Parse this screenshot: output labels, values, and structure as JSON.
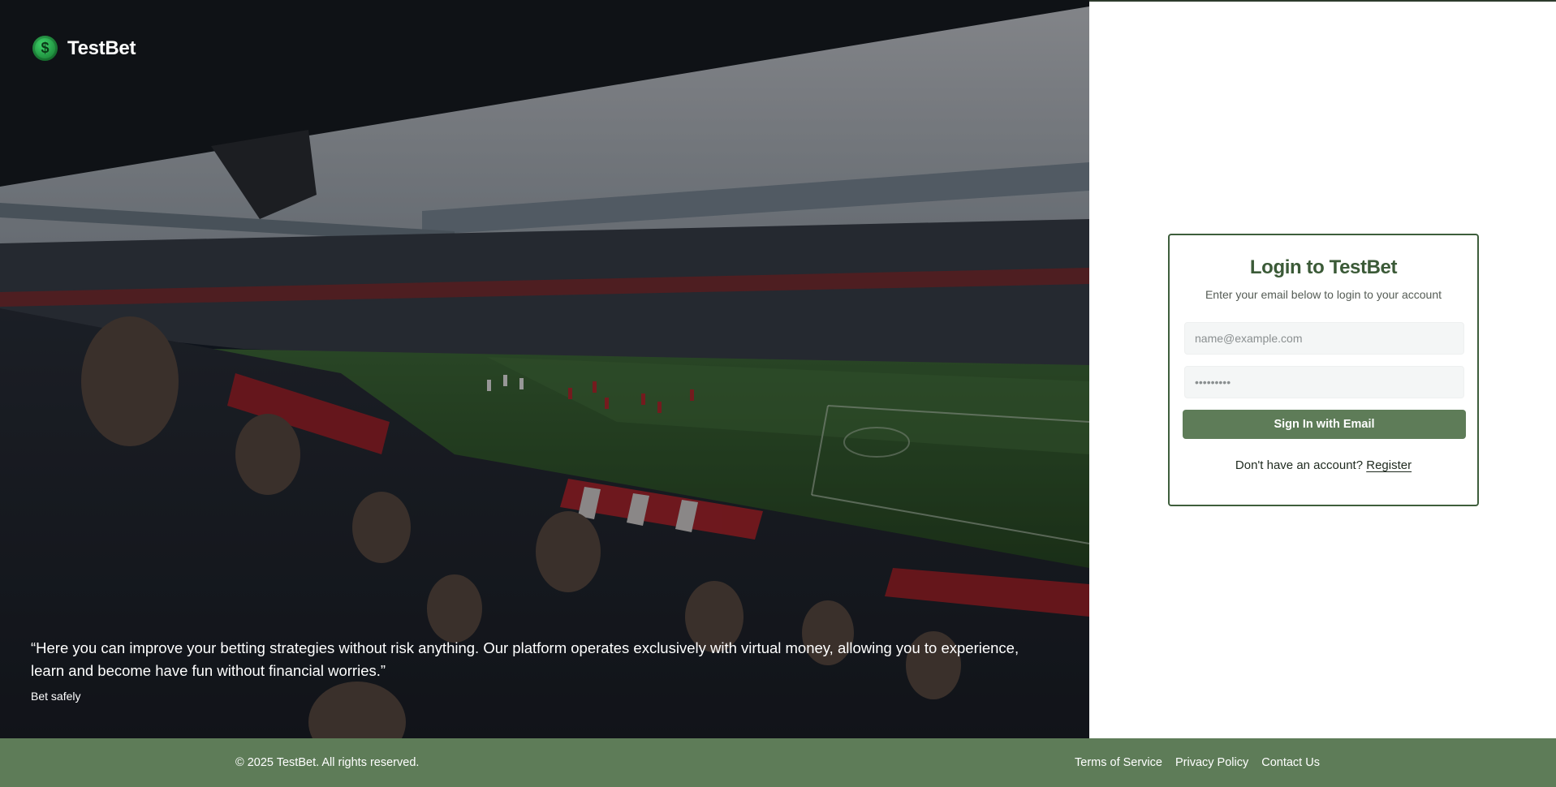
{
  "brand": {
    "name": "TestBet",
    "logo_icon": "dollar-coin-icon",
    "logo_symbol": "$"
  },
  "hero": {
    "image": "stadium-crowd-photo",
    "quote": "“Here you can improve your betting strategies without risk anything. Our platform operates exclusively with virtual money, allowing you to experience, learn and become have fun without financial worries.”",
    "author": "Bet safely"
  },
  "login": {
    "title": "Login to TestBet",
    "subtitle": "Enter your email below to login to your account",
    "email_placeholder": "name@example.com",
    "password_placeholder": "•••••••••",
    "submit_label": "Sign In with Email",
    "register_prompt": "Don't have an account?",
    "register_label": "Register"
  },
  "footer": {
    "copyright": "© 2025 TestBet. All rights reserved.",
    "links": [
      "Terms of Service",
      "Privacy Policy",
      "Contact Us"
    ]
  },
  "colors": {
    "accent": "#5e7c58",
    "title": "#3b5a37",
    "card_border": "#3e5e3c"
  }
}
